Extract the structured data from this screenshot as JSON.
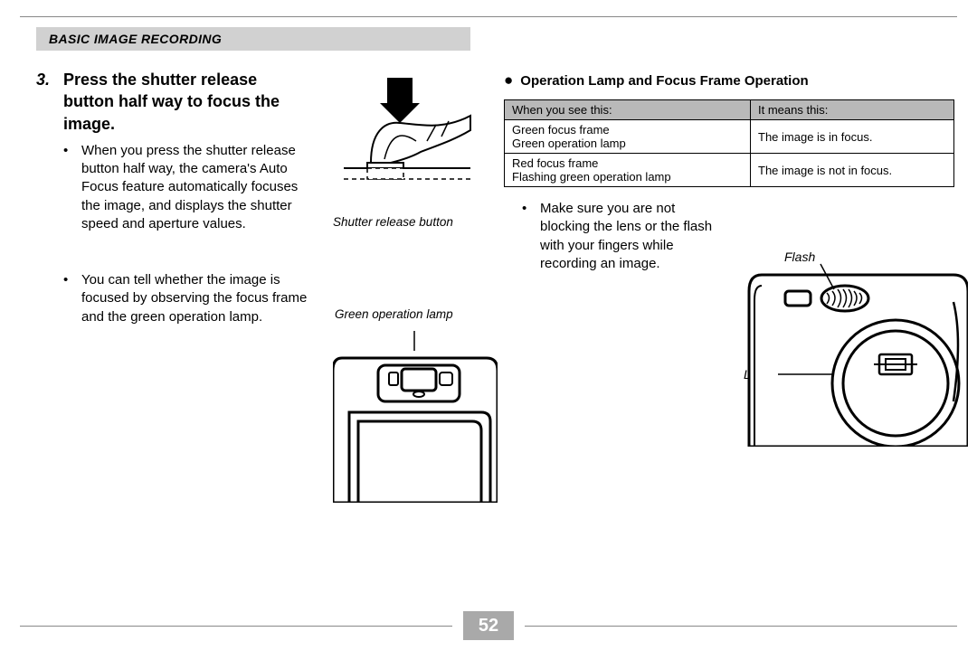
{
  "header": {
    "title": "BASIC IMAGE RECORDING"
  },
  "step": {
    "num": "3.",
    "title": "Press the shutter release button half way to focus the image."
  },
  "left": {
    "bullets": [
      "When you press the shutter release button half way, the camera's Auto Focus feature automatically focuses the image, and displays the shutter speed and aperture values.",
      "You can tell whether the image is focused by observing the focus frame and the green operation lamp."
    ]
  },
  "captions": {
    "shutter": "Shutter release button",
    "lamp": "Green operation lamp",
    "flash": "Flash",
    "lens": "Lens"
  },
  "right": {
    "subhead": "Operation Lamp and Focus Frame Operation",
    "table": {
      "headers": [
        "When you see this:",
        "It means this:"
      ],
      "rows": [
        [
          [
            "Green focus frame",
            "Green operation lamp"
          ],
          "The image is in focus."
        ],
        [
          [
            "Red focus frame",
            "Flashing green operation lamp"
          ],
          "The image is not in focus."
        ]
      ]
    },
    "bullet": "Make sure you are not blocking the lens or the flash with your fingers while recording an image."
  },
  "footer": {
    "page": "52"
  }
}
